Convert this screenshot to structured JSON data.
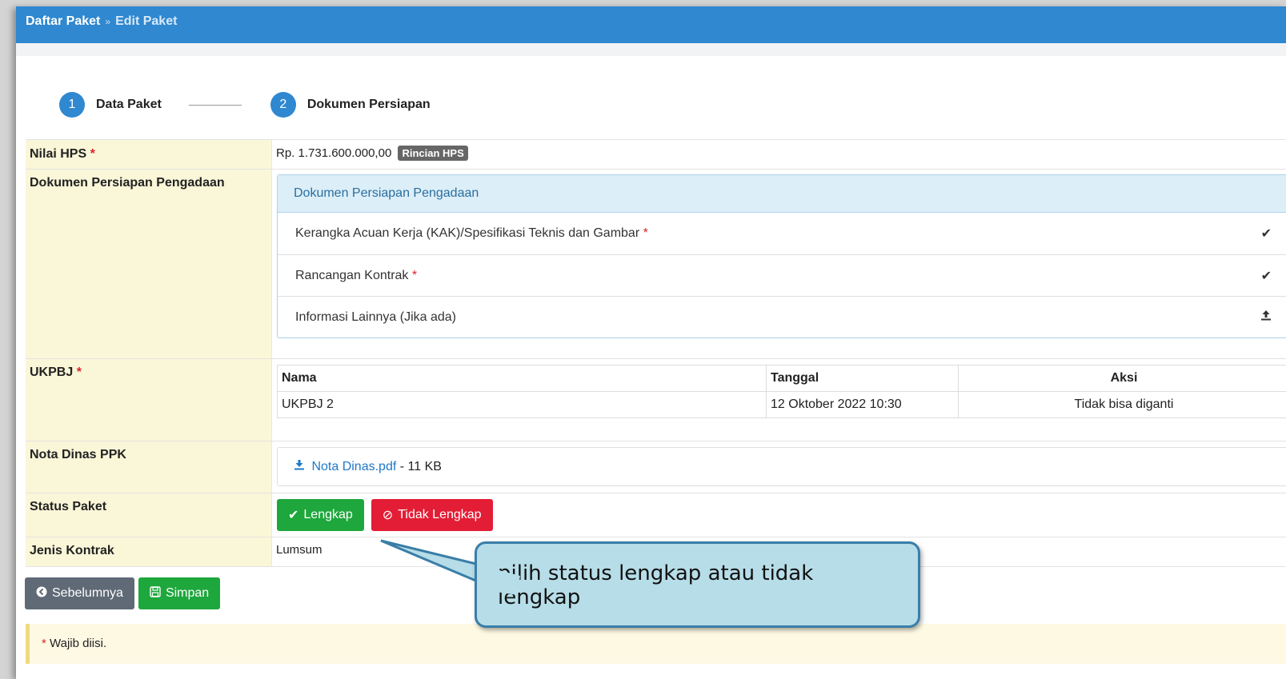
{
  "breadcrumb": {
    "root": "Daftar Paket",
    "separator": "»",
    "current": "Edit Paket"
  },
  "stepper": {
    "steps": [
      {
        "number": "1",
        "label": "Data Paket"
      },
      {
        "number": "2",
        "label": "Dokumen Persiapan"
      }
    ]
  },
  "form": {
    "nilai_hps": {
      "label": "Nilai HPS",
      "required_mark": "*",
      "value": "Rp. 1.731.600.000,00",
      "badge": "Rincian HPS"
    },
    "dokumen": {
      "label": "Dokumen Persiapan Pengadaan",
      "panel_title": "Dokumen Persiapan Pengadaan",
      "items": [
        {
          "text": "Kerangka Acuan Kerja (KAK)/Spesifikasi Teknis dan Gambar",
          "required_mark": "*",
          "icon": "check-icon"
        },
        {
          "text": "Rancangan Kontrak",
          "required_mark": "*",
          "icon": "check-icon"
        },
        {
          "text": "Informasi Lainnya (Jika ada)",
          "required_mark": "",
          "icon": "upload-icon"
        }
      ]
    },
    "ukpbj": {
      "label": "UKPBJ",
      "required_mark": "*",
      "columns": [
        "Nama",
        "Tanggal",
        "Aksi"
      ],
      "rows": [
        [
          "UKPBJ 2",
          "12 Oktober 2022 10:30",
          "Tidak bisa diganti"
        ]
      ]
    },
    "nota_dinas": {
      "label": "Nota Dinas PPK",
      "file_name": "Nota Dinas.pdf",
      "file_size": "- 11 KB"
    },
    "status_paket": {
      "label": "Status Paket",
      "lengkap": "Lengkap",
      "tidak_lengkap": "Tidak Lengkap"
    },
    "jenis_kontrak": {
      "label": "Jenis Kontrak",
      "value": "Lumsum"
    }
  },
  "footer": {
    "prev_label": "Sebelumnya",
    "save_label": "Simpan",
    "note_mark": "*",
    "note_text": "Wajib diisi."
  },
  "callout": {
    "text": "pilih status lengkap atau tidak lengkap"
  },
  "colors": {
    "topbar": "#2f88d0",
    "label_bg": "#faf6d8",
    "success": "#1ea73c",
    "danger": "#e31d35",
    "callout_bg": "#b6dde8"
  }
}
